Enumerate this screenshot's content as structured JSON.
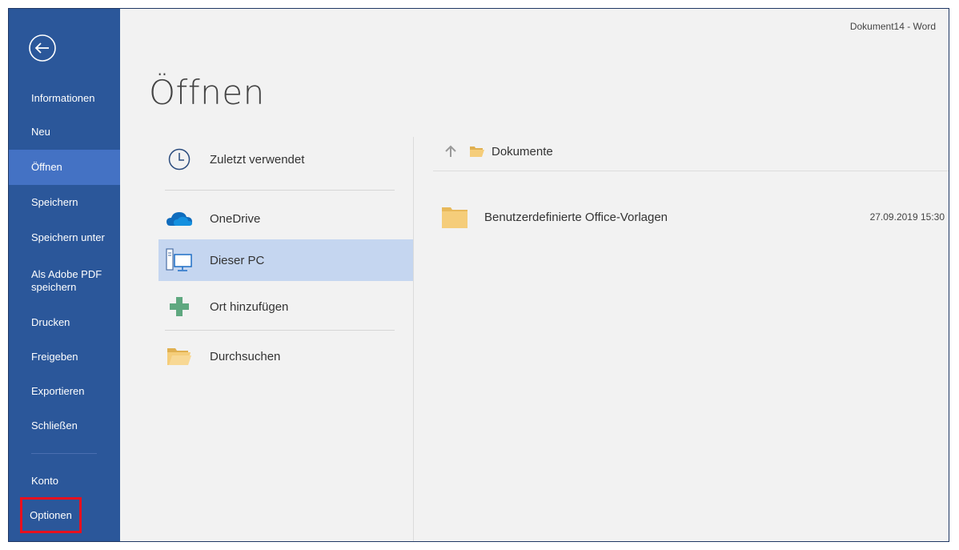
{
  "window": {
    "title": "Dokument14 - Word"
  },
  "sidebar": {
    "items": [
      {
        "label": "Informationen"
      },
      {
        "label": "Neu"
      },
      {
        "label": "Öffnen"
      },
      {
        "label": "Speichern"
      },
      {
        "label": "Speichern unter"
      },
      {
        "label": "Als Adobe PDF speichern"
      },
      {
        "label": "Drucken"
      },
      {
        "label": "Freigeben"
      },
      {
        "label": "Exportieren"
      },
      {
        "label": "Schließen"
      },
      {
        "label": "Konto"
      },
      {
        "label": "Optionen"
      }
    ],
    "active_index": 2,
    "highlighted_item": "Optionen"
  },
  "page": {
    "title": "Öffnen"
  },
  "locations": [
    {
      "label": "Zuletzt verwendet",
      "icon": "clock-icon"
    },
    {
      "label": "OneDrive",
      "icon": "cloud-icon"
    },
    {
      "label": "Dieser PC",
      "icon": "computer-icon"
    },
    {
      "label": "Ort hinzufügen",
      "icon": "plus-icon"
    },
    {
      "label": "Durchsuchen",
      "icon": "open-folder-icon"
    }
  ],
  "selected_location": "Dieser PC",
  "files": {
    "breadcrumb": "Dokumente",
    "rows": [
      {
        "name": "Benutzerdefinierte Office-Vorlagen",
        "modified": "27.09.2019 15:30",
        "icon": "folder-icon"
      }
    ]
  },
  "colors": {
    "sidebar": "#2b579a",
    "sidebar_active": "#4472c4",
    "selected_location": "#c5d6f0",
    "highlight_border": "#e8101e"
  }
}
